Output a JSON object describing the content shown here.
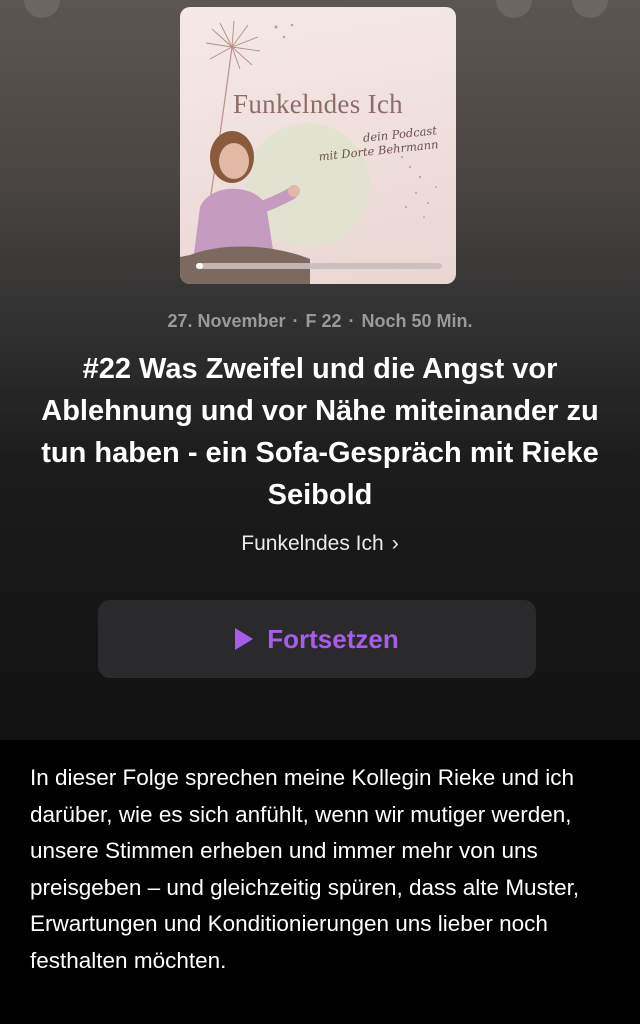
{
  "episode": {
    "date": "27. November",
    "episode_code": "F 22",
    "remaining": "Noch 50 Min.",
    "separator": "·",
    "title": "#22 Was Zweifel und die Angst vor Ablehnung und vor Nähe miteinander zu tun haben - ein Sofa-Gespräch mit Rieke Seibold",
    "progress_fraction": 0.03
  },
  "artwork": {
    "title": "Funkelndes Ich",
    "subtitle_lines": [
      "dein Podcast",
      "mit Dorte Behrmann"
    ]
  },
  "show": {
    "name": "Funkelndes Ich",
    "chevron": "›"
  },
  "actions": {
    "resume_label": "Fortsetzen",
    "accent_color": "#a65ee8"
  },
  "description": "In dieser Folge sprechen meine Kollegin Rieke und ich darüber, wie es sich anfühlt, wenn wir mutiger werden, unsere Stimmen erheben und immer mehr von uns preisgeben – und gleichzeitig spüren, dass alte Muster, Erwartungen und Konditionierungen uns lieber noch festhalten möchten."
}
